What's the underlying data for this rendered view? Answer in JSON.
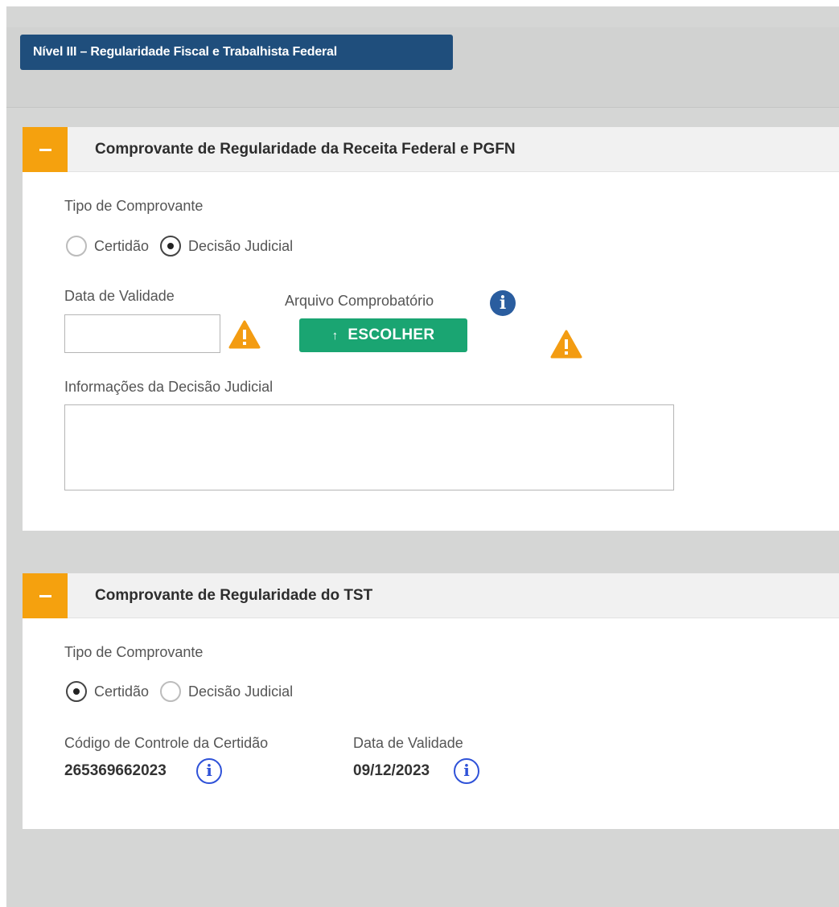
{
  "level": {
    "label": "Nível III – Regularidade Fiscal e Trabalhista Federal"
  },
  "colors": {
    "level_bg": "#1f4e7c",
    "accent_orange": "#f5a10e",
    "button_green": "#1aa572",
    "warning": "#f39c12",
    "info_blue": "#2a5d9f"
  },
  "section1": {
    "title": "Comprovante de Regularidade da Receita Federal e PGFN",
    "tipo_label": "Tipo de Comprovante",
    "options": [
      {
        "label": "Certidão",
        "checked": false
      },
      {
        "label": "Decisão Judicial",
        "checked": true
      }
    ],
    "data_validade_label": "Data de Validade",
    "data_validade_value": "",
    "arquivo_label": "Arquivo Comprobatório",
    "escolher_label": "ESCOLHER",
    "info_decisao_label": "Informações da Decisão Judicial",
    "info_decisao_value": "",
    "icons": {
      "info": "info-icon",
      "warning": "warning-icon",
      "upload": "upload-arrow-icon"
    }
  },
  "section2": {
    "title": "Comprovante de Regularidade do TST",
    "tipo_label": "Tipo de Comprovante",
    "options": [
      {
        "label": "Certidão",
        "checked": true
      },
      {
        "label": "Decisão Judicial",
        "checked": false
      }
    ],
    "codigo_label": "Código de Controle da Certidão",
    "codigo_value": "265369662023",
    "data_validade_label": "Data de Validade",
    "data_validade_value": "09/12/2023"
  }
}
